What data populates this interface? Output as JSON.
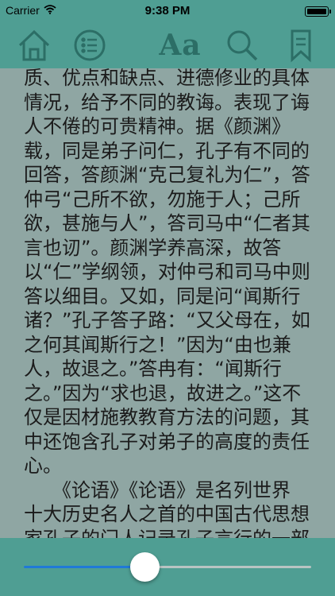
{
  "status": {
    "carrier": "Carrier",
    "time": "9:38 PM"
  },
  "toolbar": {
    "font_label": "Aa",
    "icons": [
      "home-icon",
      "list-icon",
      "font-icon",
      "search-icon",
      "bookmark-icon"
    ]
  },
  "reader": {
    "lines": [
      "质、优点和缺点、进德修业的具体",
      "情况，给予不同的教诲。表现了诲",
      "人不倦的可贵精神。据《颜渊》",
      "载，同是弟子问仁，孔子有不同的",
      "回答，答颜渊“克己复礼为仁”，答",
      "仲弓“己所不欲，勿施于人；己所",
      "欲，甚施与人”，答司马中“仁者其",
      "言也讱”。颜渊学养高深，故答",
      "以“仁”学纲领，对仲弓和司马中则",
      "答以细目。又如，同是问“闻斯行",
      "诸？”孔子答子路：“又父母在，如",
      "之何其闻斯行之！”因为“由也兼",
      "人，故退之。”答冉有：“闻斯行",
      "之。”因为“求也退，故进之。”这不",
      "仅是因材施教教育方法的问题，其",
      "中还饱含孔子对弟子的高度的责任",
      "心。",
      "　　《论语》《论语》是名列世界",
      "十大历史名人之首的中国古代思想",
      "家孔子的门人记录孔子言行的一部"
    ]
  },
  "slider": {
    "progress": 0.42
  },
  "colors": {
    "bar": "#4f9e93",
    "background": "#8fa6a3",
    "icon": "#2c6e66",
    "slider_fill": "#2079d8"
  }
}
